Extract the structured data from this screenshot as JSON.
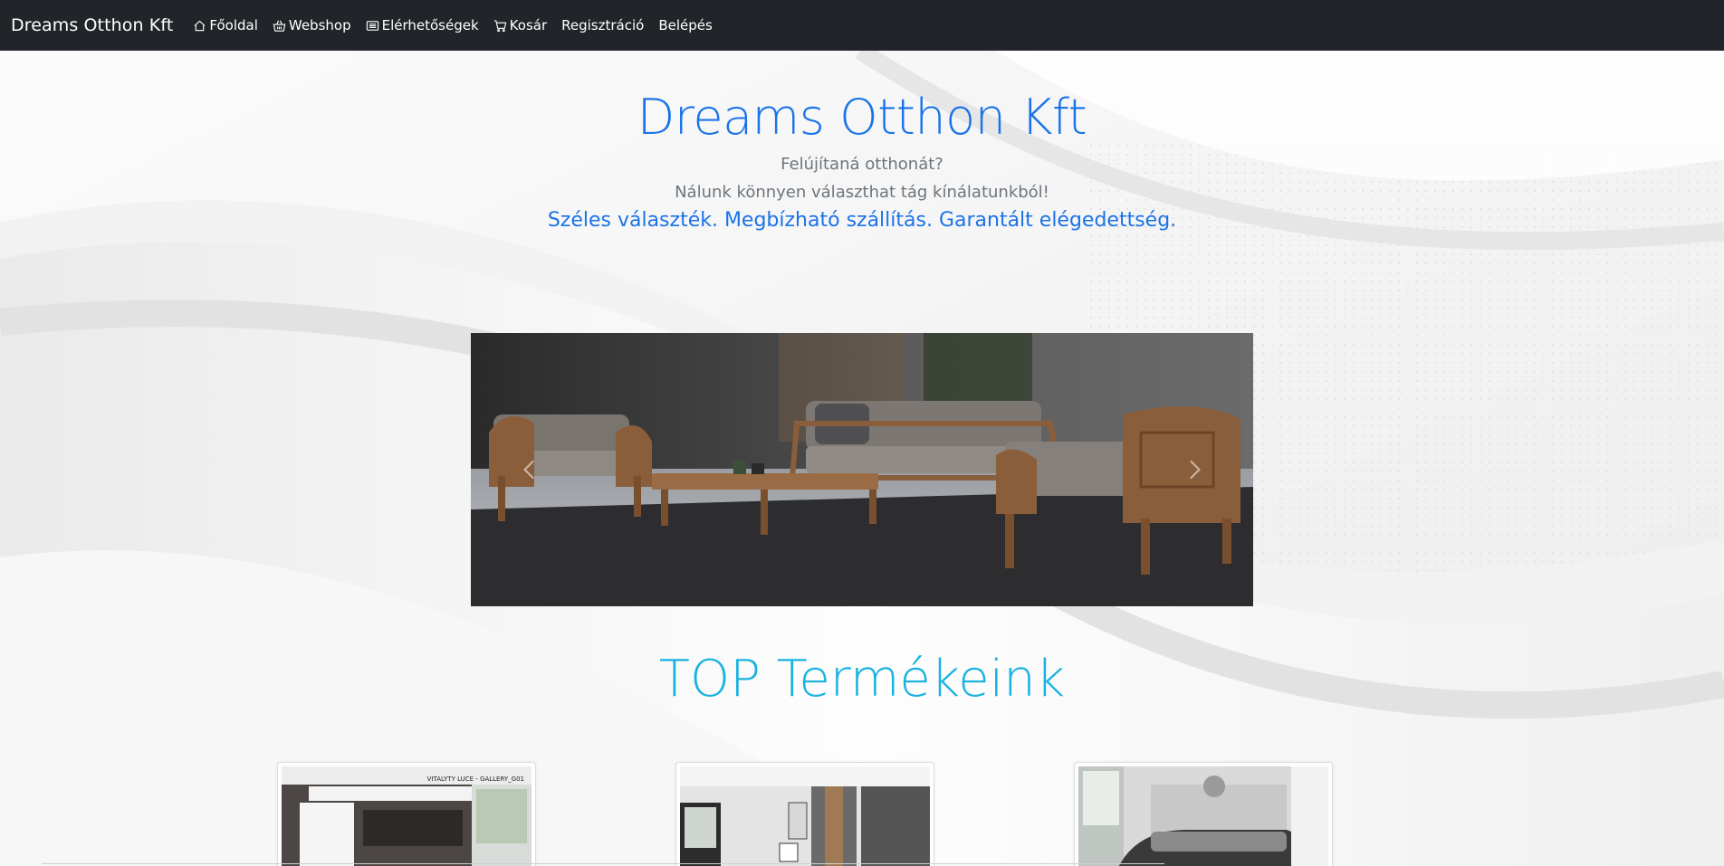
{
  "navbar": {
    "brand": "Dreams Otthon Kft",
    "items": [
      {
        "label": "Főoldal",
        "icon": "house-icon"
      },
      {
        "label": "Webshop",
        "icon": "basket-icon"
      },
      {
        "label": "Elérhetőségek",
        "icon": "card-list-icon"
      },
      {
        "label": "Kosár",
        "icon": "cart-icon"
      },
      {
        "label": "Regisztráció",
        "icon": ""
      },
      {
        "label": "Belépés",
        "icon": ""
      }
    ]
  },
  "hero": {
    "title": "Dreams Otthon Kft",
    "line1": "Felújítaná otthonát?",
    "line2": "Nálunk könnyen választhat tág kínálatunkból!",
    "tagline": "Széles választék. Megbízható szállítás. Garantált elégedettség."
  },
  "carousel": {
    "prev_icon": "chevron-left-icon",
    "next_icon": "chevron-right-icon"
  },
  "top_products": {
    "title": "TOP Termékeink",
    "cards": [
      {
        "label": "VITALYTY LUCE - GALLERY_G01"
      },
      {
        "label": ""
      },
      {
        "label": ""
      }
    ]
  },
  "colors": {
    "navbar_bg": "#212529",
    "primary_blue": "#1a73e8",
    "cyan_title": "#17b3e0",
    "muted_text": "#6c757d"
  }
}
